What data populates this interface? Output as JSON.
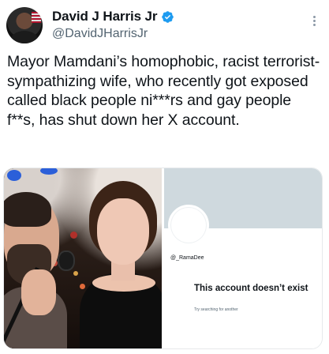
{
  "author": {
    "display_name": "David J Harris Jr",
    "handle": "@DavidJHarrisJr",
    "verified": true
  },
  "tweet": {
    "text": "Mayor Mamdani’s homophobic, racist terrorist-sympathizing wife, who recently got exposed called black people ni***rs and gay people f**s, has shut down her X account."
  },
  "media": {
    "left_photo": "photo of two people at a microphone",
    "right_screenshot": {
      "handle": "@_RamaDee",
      "title": "This account doesn’t exist",
      "subtitle": "Try searching for another"
    }
  },
  "colors": {
    "verified_blue": "#1d9bf0",
    "handle_gray": "#536471",
    "banner_gray": "#cfd9de"
  },
  "icons": {
    "verified": "verified-badge-icon",
    "more": "more-options-icon"
  }
}
